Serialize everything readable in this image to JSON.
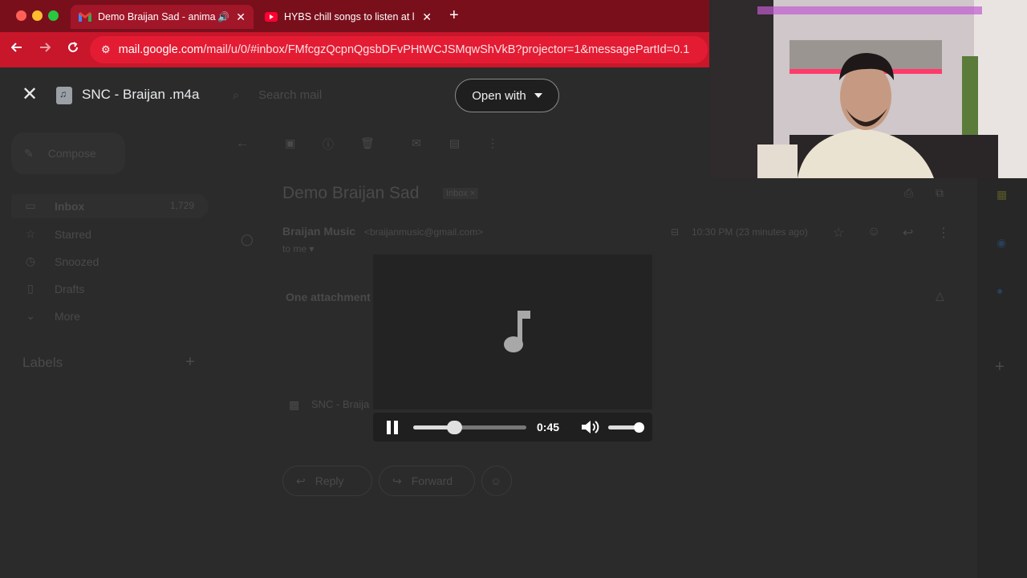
{
  "browser": {
    "tabs": [
      {
        "title": "Demo Braijan Sad - anima",
        "active": true,
        "audio": true
      },
      {
        "title": "HYBS chill songs to listen at l",
        "active": false
      }
    ],
    "new_tab_glyph": "+",
    "close_glyph": "✕",
    "url": {
      "domain": "mail.google.com",
      "path": "/mail/u/0/#inbox/FMfcgzQcpnQgsbDFvPHtWCJSMqwShVkB?projector=1&messagePartId=0.1"
    }
  },
  "gmail": {
    "search_placeholder": "Search mail",
    "compose_label": "Compose",
    "sidebar": [
      {
        "label": "Inbox",
        "count": "1,729",
        "icon": "inbox-icon"
      },
      {
        "label": "Starred",
        "icon": "star-icon"
      },
      {
        "label": "Snoozed",
        "icon": "clock-icon"
      },
      {
        "label": "Drafts",
        "icon": "draft-icon"
      },
      {
        "label": "More",
        "icon": "chevron-down-icon"
      }
    ],
    "labels_heading": "Labels",
    "email": {
      "subject": "Demo Braijan Sad",
      "label_chip": "Inbox ×",
      "sender_name": "Braijan Music",
      "sender_email": "<braijanmusic@gmail.com>",
      "time": "10:30 PM (23 minutes ago)",
      "to": "to me ▾",
      "attachment_heading": "One attachment",
      "attachment_name": "SNC - Braija",
      "reply_label": "Reply",
      "forward_label": "Forward"
    }
  },
  "viewer": {
    "file_title": "SNC - Braijan .m4a",
    "open_with_label": "Open with",
    "player": {
      "time": "0:45",
      "seek_fraction": 0.36,
      "volume_fraction": 0.95,
      "playing": true
    }
  },
  "colors": {
    "tab_bar": "#7a0f1c",
    "address_bar": "#c8162a",
    "url_pill": "#e31c33",
    "overlay_bg": "#2b2b2b"
  }
}
